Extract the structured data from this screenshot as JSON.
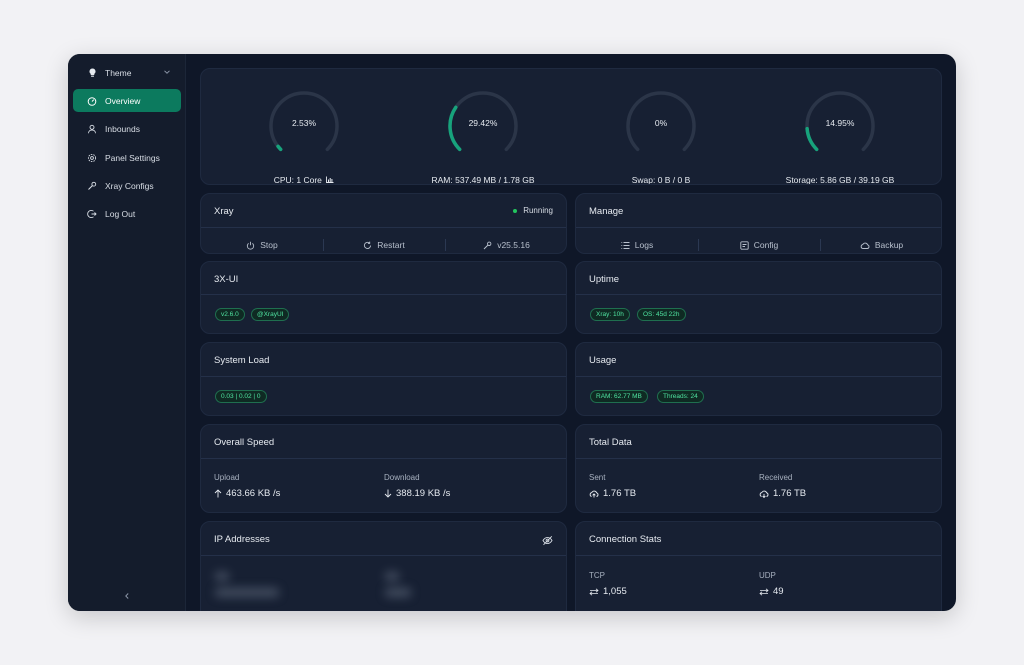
{
  "sidebar": {
    "theme_label": "Theme",
    "items": [
      {
        "label": "Overview"
      },
      {
        "label": "Inbounds"
      },
      {
        "label": "Panel Settings"
      },
      {
        "label": "Xray Configs"
      },
      {
        "label": "Log Out"
      }
    ]
  },
  "gauges": [
    {
      "value": "2.53%",
      "label": "CPU: 1 Core",
      "percent": 2.53
    },
    {
      "value": "29.42%",
      "label": "RAM: 537.49 MB / 1.78 GB",
      "percent": 29.42
    },
    {
      "value": "0%",
      "label": "Swap: 0 B / 0 B",
      "percent": 0
    },
    {
      "value": "14.95%",
      "label": "Storage: 5.86 GB / 39.19 GB",
      "percent": 14.95
    }
  ],
  "xray": {
    "title": "Xray",
    "status": "Running",
    "actions": {
      "stop": "Stop",
      "restart": "Restart",
      "version": "v25.5.16"
    }
  },
  "manage": {
    "title": "Manage",
    "actions": {
      "logs": "Logs",
      "config": "Config",
      "backup": "Backup"
    }
  },
  "panel_info": {
    "title": "3X-UI",
    "tags": [
      "v2.6.0",
      "@XrayUI"
    ]
  },
  "uptime": {
    "title": "Uptime",
    "tags": [
      "Xray: 10h",
      "OS: 45d 22h"
    ]
  },
  "system_load": {
    "title": "System Load",
    "tags": [
      "0.03 | 0.02 | 0"
    ]
  },
  "usage": {
    "title": "Usage",
    "tags": [
      "RAM: 62.77 MB",
      "Threads: 24"
    ]
  },
  "speed": {
    "title": "Overall Speed",
    "upload_label": "Upload",
    "upload_value": "463.66 KB /s",
    "download_label": "Download",
    "download_value": "388.19 KB /s"
  },
  "total_data": {
    "title": "Total Data",
    "sent_label": "Sent",
    "sent_value": "1.76 TB",
    "received_label": "Received",
    "received_value": "1.76 TB"
  },
  "ip": {
    "title": "IP Addresses"
  },
  "connections": {
    "title": "Connection Stats",
    "tcp_label": "TCP",
    "tcp_value": "1,055",
    "udp_label": "UDP",
    "udp_value": "49"
  },
  "colors": {
    "accent": "#0c7a5e",
    "gauge_track": "#2b3548",
    "gauge_fill": "#17a37c"
  }
}
